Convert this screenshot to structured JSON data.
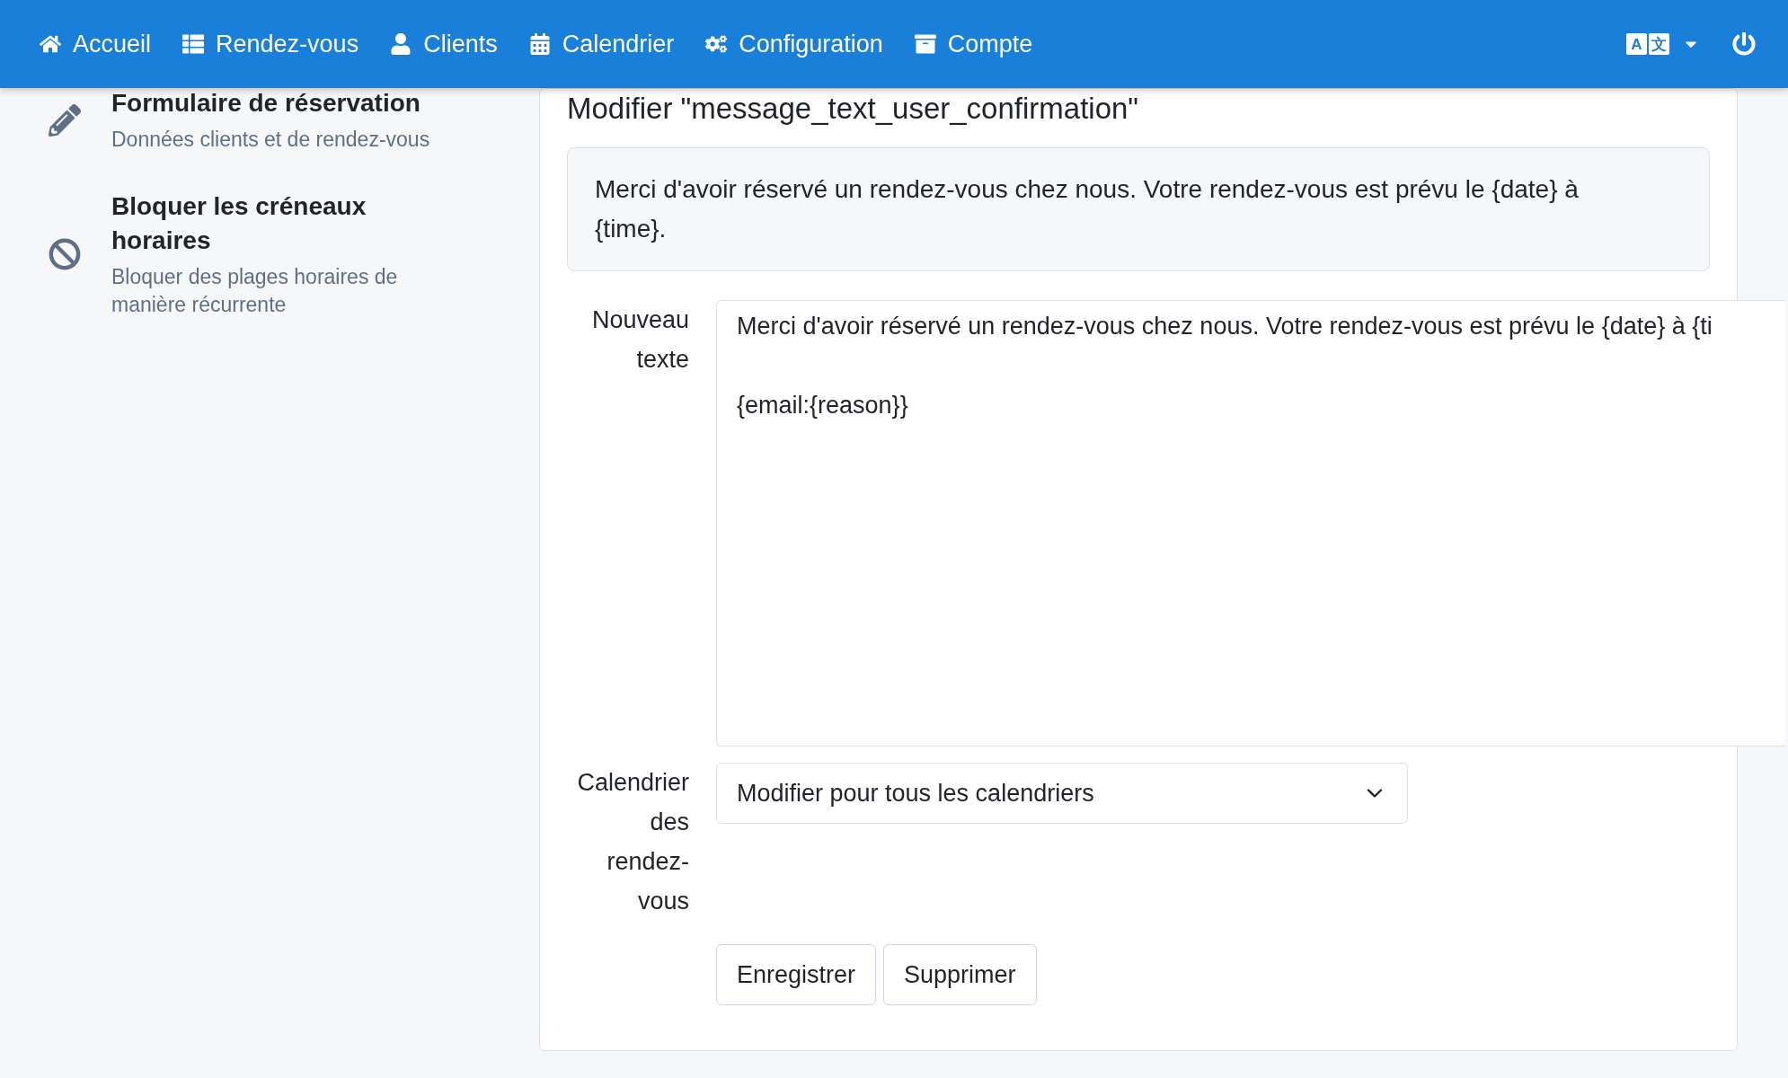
{
  "navbar": {
    "items": [
      {
        "label": "Accueil",
        "kind": "home"
      },
      {
        "label": "Rendez-vous",
        "kind": "list"
      },
      {
        "label": "Clients",
        "kind": "user"
      },
      {
        "label": "Calendrier",
        "kind": "calendar"
      },
      {
        "label": "Configuration",
        "kind": "cogs"
      },
      {
        "label": "Compte",
        "kind": "archive"
      }
    ],
    "language_glyphs": [
      "A",
      "文"
    ]
  },
  "sidebar": {
    "items": [
      {
        "title": "Formulaire de réservation",
        "subtitle": "Données clients et de rendez-vous",
        "kind": "pencil"
      },
      {
        "title": "Bloquer les créneaux horaires",
        "subtitle": "Bloquer des plages horaires de manière récurrente",
        "kind": "ban"
      }
    ]
  },
  "page_title": "Modifier \"message_text_user_confirmation\"",
  "current_text": "Merci d'avoir réservé un rendez-vous chez nous. Votre rendez-vous est prévu le {date} à {time}.",
  "form": {
    "fields": [
      {
        "label": "Nouveau texte",
        "kind": "textarea",
        "value": "Merci d'avoir réservé un rendez-vous chez nous. Votre rendez-vous est prévu le {date} à {ti\n\n{email:{reason}}"
      },
      {
        "label": "Calendrier des rendez-vous",
        "kind": "select",
        "value": "Modifier pour tous les calendriers"
      }
    ],
    "buttons": [
      "Enregistrer",
      "Supprimer"
    ]
  }
}
